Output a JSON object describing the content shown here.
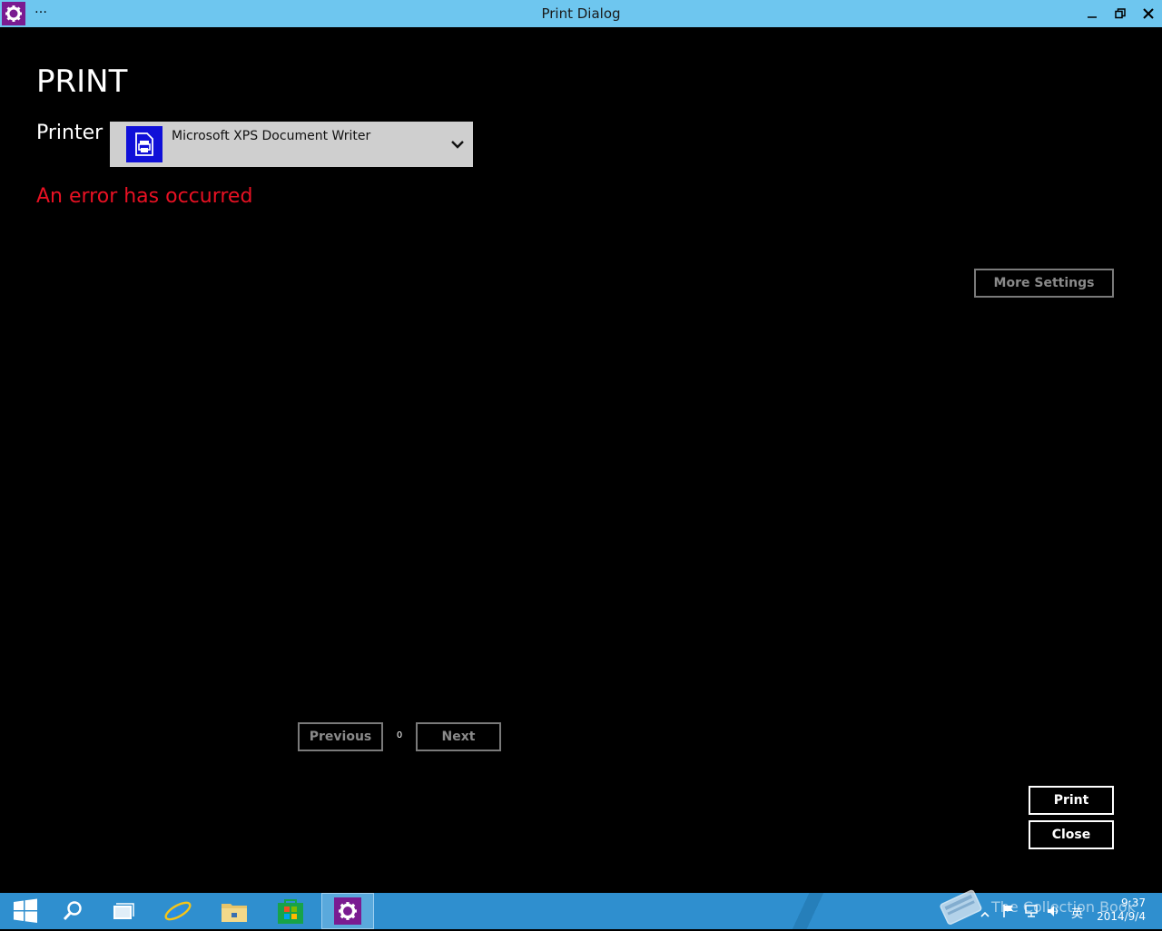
{
  "window": {
    "title": "Print Dialog",
    "menu_dots": "…"
  },
  "dialog": {
    "heading": "PRINT",
    "printer_label": "Printer",
    "printer_selected": "Microsoft XPS Document Writer",
    "error_message": "An error has occurred",
    "more_settings_label": "More Settings",
    "previous_label": "Previous",
    "page_number": "0",
    "next_label": "Next",
    "print_label": "Print",
    "close_label": "Close"
  },
  "taskbar": {
    "ime": "英",
    "time": "9:37",
    "date": "2014/9/4",
    "watermark": "The Collection Book"
  },
  "colors": {
    "titlebar": "#6ec6ef",
    "error": "#e81123",
    "taskbar": "#2f8fcf",
    "app_icon": "#7a1b91",
    "printer_icon": "#1010d8"
  },
  "icons": [
    "gear-icon",
    "minimize-icon",
    "restore-icon",
    "close-icon",
    "printer-icon",
    "chevron-down-icon",
    "windows-start-icon",
    "search-icon",
    "task-view-icon",
    "internet-explorer-icon",
    "file-explorer-icon",
    "store-icon"
  ]
}
